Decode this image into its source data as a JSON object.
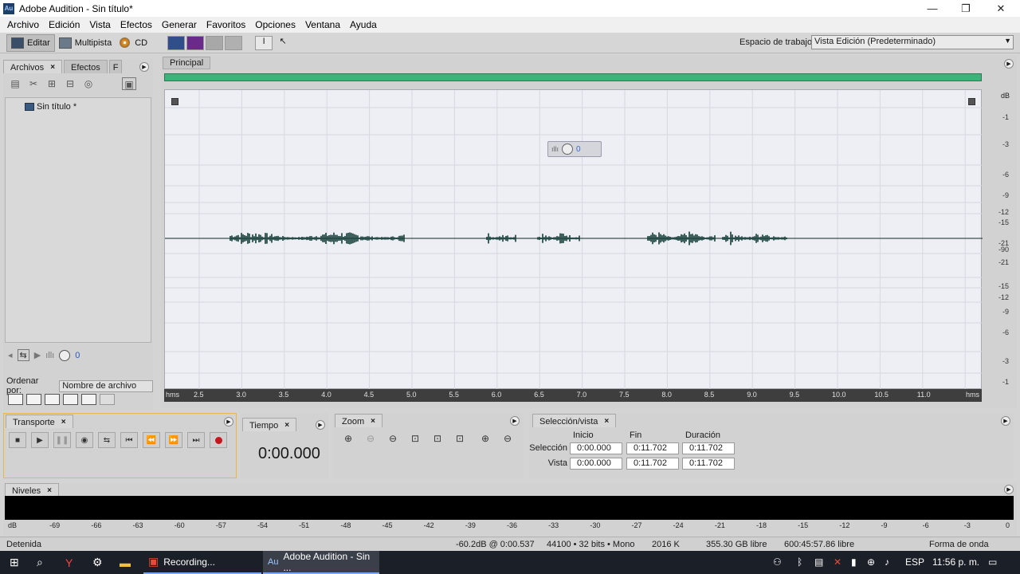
{
  "window": {
    "logo": "Au",
    "title": "Adobe Audition - Sin título*",
    "minimize": "—",
    "maximize": "❐",
    "close": "✕"
  },
  "menu": [
    "Archivo",
    "Edición",
    "Vista",
    "Efectos",
    "Generar",
    "Favoritos",
    "Opciones",
    "Ventana",
    "Ayuda"
  ],
  "toolbar": {
    "modes": [
      "Editar",
      "Multipista",
      "CD"
    ],
    "workspace_label": "Espacio de trabajo",
    "workspace_value": "Vista Edición (Predeterminado)"
  },
  "left_panel": {
    "tabs": [
      "Archivos",
      "Efectos",
      "F"
    ],
    "file_name": "Sin título *",
    "volume_value": "0",
    "sort_label": "Ordenar por:",
    "sort_value": "Nombre de archivo"
  },
  "editor": {
    "tab": "Principal",
    "volume_value": "0",
    "db_unit": "dB",
    "db_ticks": [
      "-1",
      "-3",
      "-6",
      "-9",
      "-12",
      "-15",
      "-21",
      "-90",
      "-21",
      "-15",
      "-12",
      "-9",
      "-6",
      "-3",
      "-1"
    ],
    "time_labels": [
      "hms",
      "2.5",
      "3.0",
      "3.5",
      "4.0",
      "4.5",
      "5.0",
      "5.5",
      "6.0",
      "6.5",
      "7.0",
      "7.5",
      "8.0",
      "8.5",
      "9.0",
      "9.5",
      "10.0",
      "10.5",
      "11.0",
      "hms"
    ]
  },
  "transport": {
    "title": "Transporte"
  },
  "time_panel": {
    "title": "Tiempo",
    "value": "0:00.000"
  },
  "zoom_panel": {
    "title": "Zoom"
  },
  "selection_panel": {
    "title": "Selección/vista",
    "headers": [
      "Inicio",
      "Fin",
      "Duración"
    ],
    "rows": [
      {
        "label": "Selección",
        "values": [
          "0:00.000",
          "0:11.702",
          "0:11.702"
        ]
      },
      {
        "label": "Vista",
        "values": [
          "0:00.000",
          "0:11.702",
          "0:11.702"
        ]
      }
    ]
  },
  "levels": {
    "title": "Niveles",
    "ticks": [
      "dB",
      "-69",
      "-66",
      "-63",
      "-60",
      "-57",
      "-54",
      "-51",
      "-48",
      "-45",
      "-42",
      "-39",
      "-36",
      "-33",
      "-30",
      "-27",
      "-24",
      "-21",
      "-18",
      "-15",
      "-12",
      "-9",
      "-6",
      "-3",
      "0"
    ]
  },
  "status": {
    "state": "Detenida",
    "level": "-60.2dB @  0:00.537",
    "format": "44100 • 32 bits • Mono",
    "size": "2016 K",
    "free": "355.30 GB libre",
    "time_free": "600:45:57.86 libre",
    "view": "Forma de onda"
  },
  "taskbar": {
    "recording": "Recording...",
    "audition": "Adobe Audition - Sin ...",
    "lang": "ESP",
    "clock": "11:56 p. m."
  }
}
